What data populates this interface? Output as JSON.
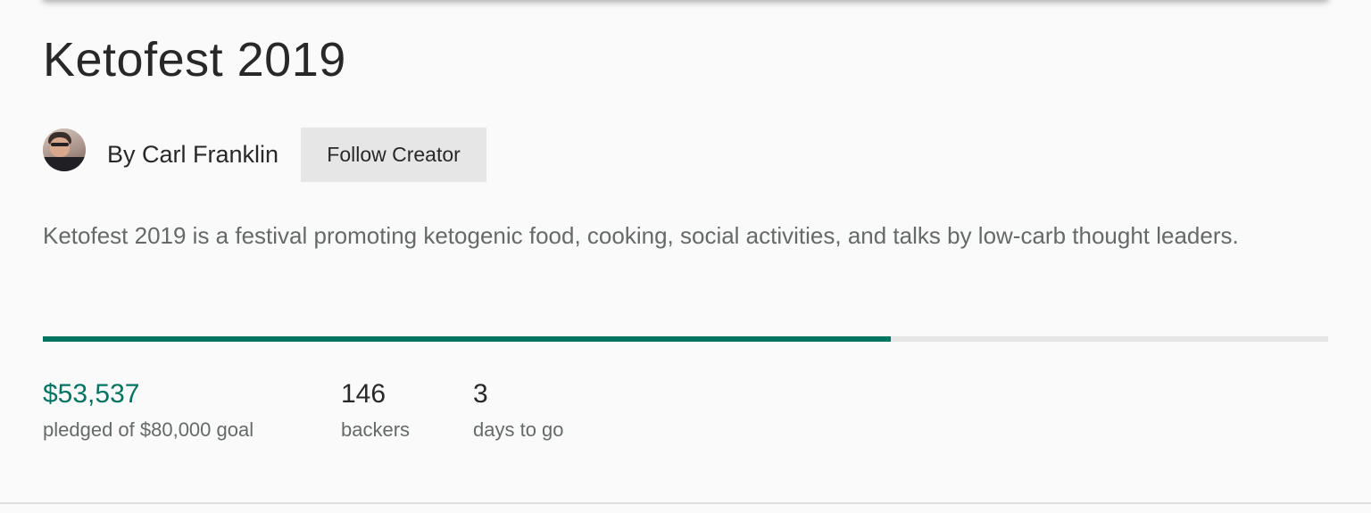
{
  "project": {
    "title": "Ketofest 2019",
    "description": "Ketofest 2019 is a festival promoting ketogenic food, cooking, social activities, and talks by low-carb thought leaders."
  },
  "creator": {
    "by_label": "By Carl Franklin",
    "follow_label": "Follow Creator",
    "avatar_icon": "avatar-photo"
  },
  "funding": {
    "pledged": "$53,537",
    "pledged_label": "pledged of $80,000 goal",
    "progress_fraction": 0.66,
    "backers": "146",
    "backers_label": "backers",
    "days": "3",
    "days_label": "days to go"
  },
  "colors": {
    "accent": "#037362",
    "track": "#e6e6e6",
    "button_bg": "#e6e6e6"
  }
}
